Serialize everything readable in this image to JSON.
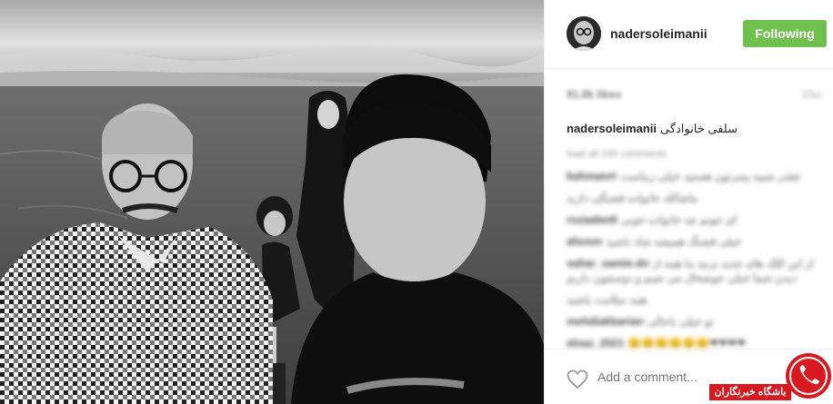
{
  "post": {
    "username": "nadersoleimanii",
    "follow_label": "Following",
    "likes": "91.8k likes",
    "time_ago": "33w",
    "caption_user": "nadersoleimanii",
    "caption_text": "سلفی خانوادگی",
    "load_more": "load all 335 comments",
    "comments": [
      {
        "user": "bahmanrt",
        "text": "چقدر شبیه پسرتون هستید خیلی زیباست"
      },
      {
        "user": "",
        "text": "ماشالله خانواده قشنگی دارید"
      },
      {
        "user": "rozaabedi",
        "text": "ای جونم چه خانواده خوبی"
      },
      {
        "user": "afsoon",
        "text": "خیلی قشنگ همیشه شاد باشید"
      },
      {
        "user": "sahar_samie.dn",
        "text": "از این کلک های جدید نزنید ما همه از دیدن شما خیلی خوشحال می شیم و دوستتون داریم"
      },
      {
        "user": "",
        "text": "همه سلامت باشید"
      },
      {
        "user": "mehdiakbarian",
        "text": "تو خیلی باحالی"
      },
      {
        "user": "elnaz_2021",
        "text": "😊😊😊😊😊😊❤❤❤❤"
      }
    ],
    "add_comment_placeholder": "Add a comment..."
  },
  "watermark": {
    "text": "باشگاه خبرنگاران"
  },
  "colors": {
    "follow_green": "#70c050",
    "watermark_red": "#d71920"
  },
  "icons": {
    "heart": "heart-outline-icon",
    "avatar": "profile-avatar"
  }
}
